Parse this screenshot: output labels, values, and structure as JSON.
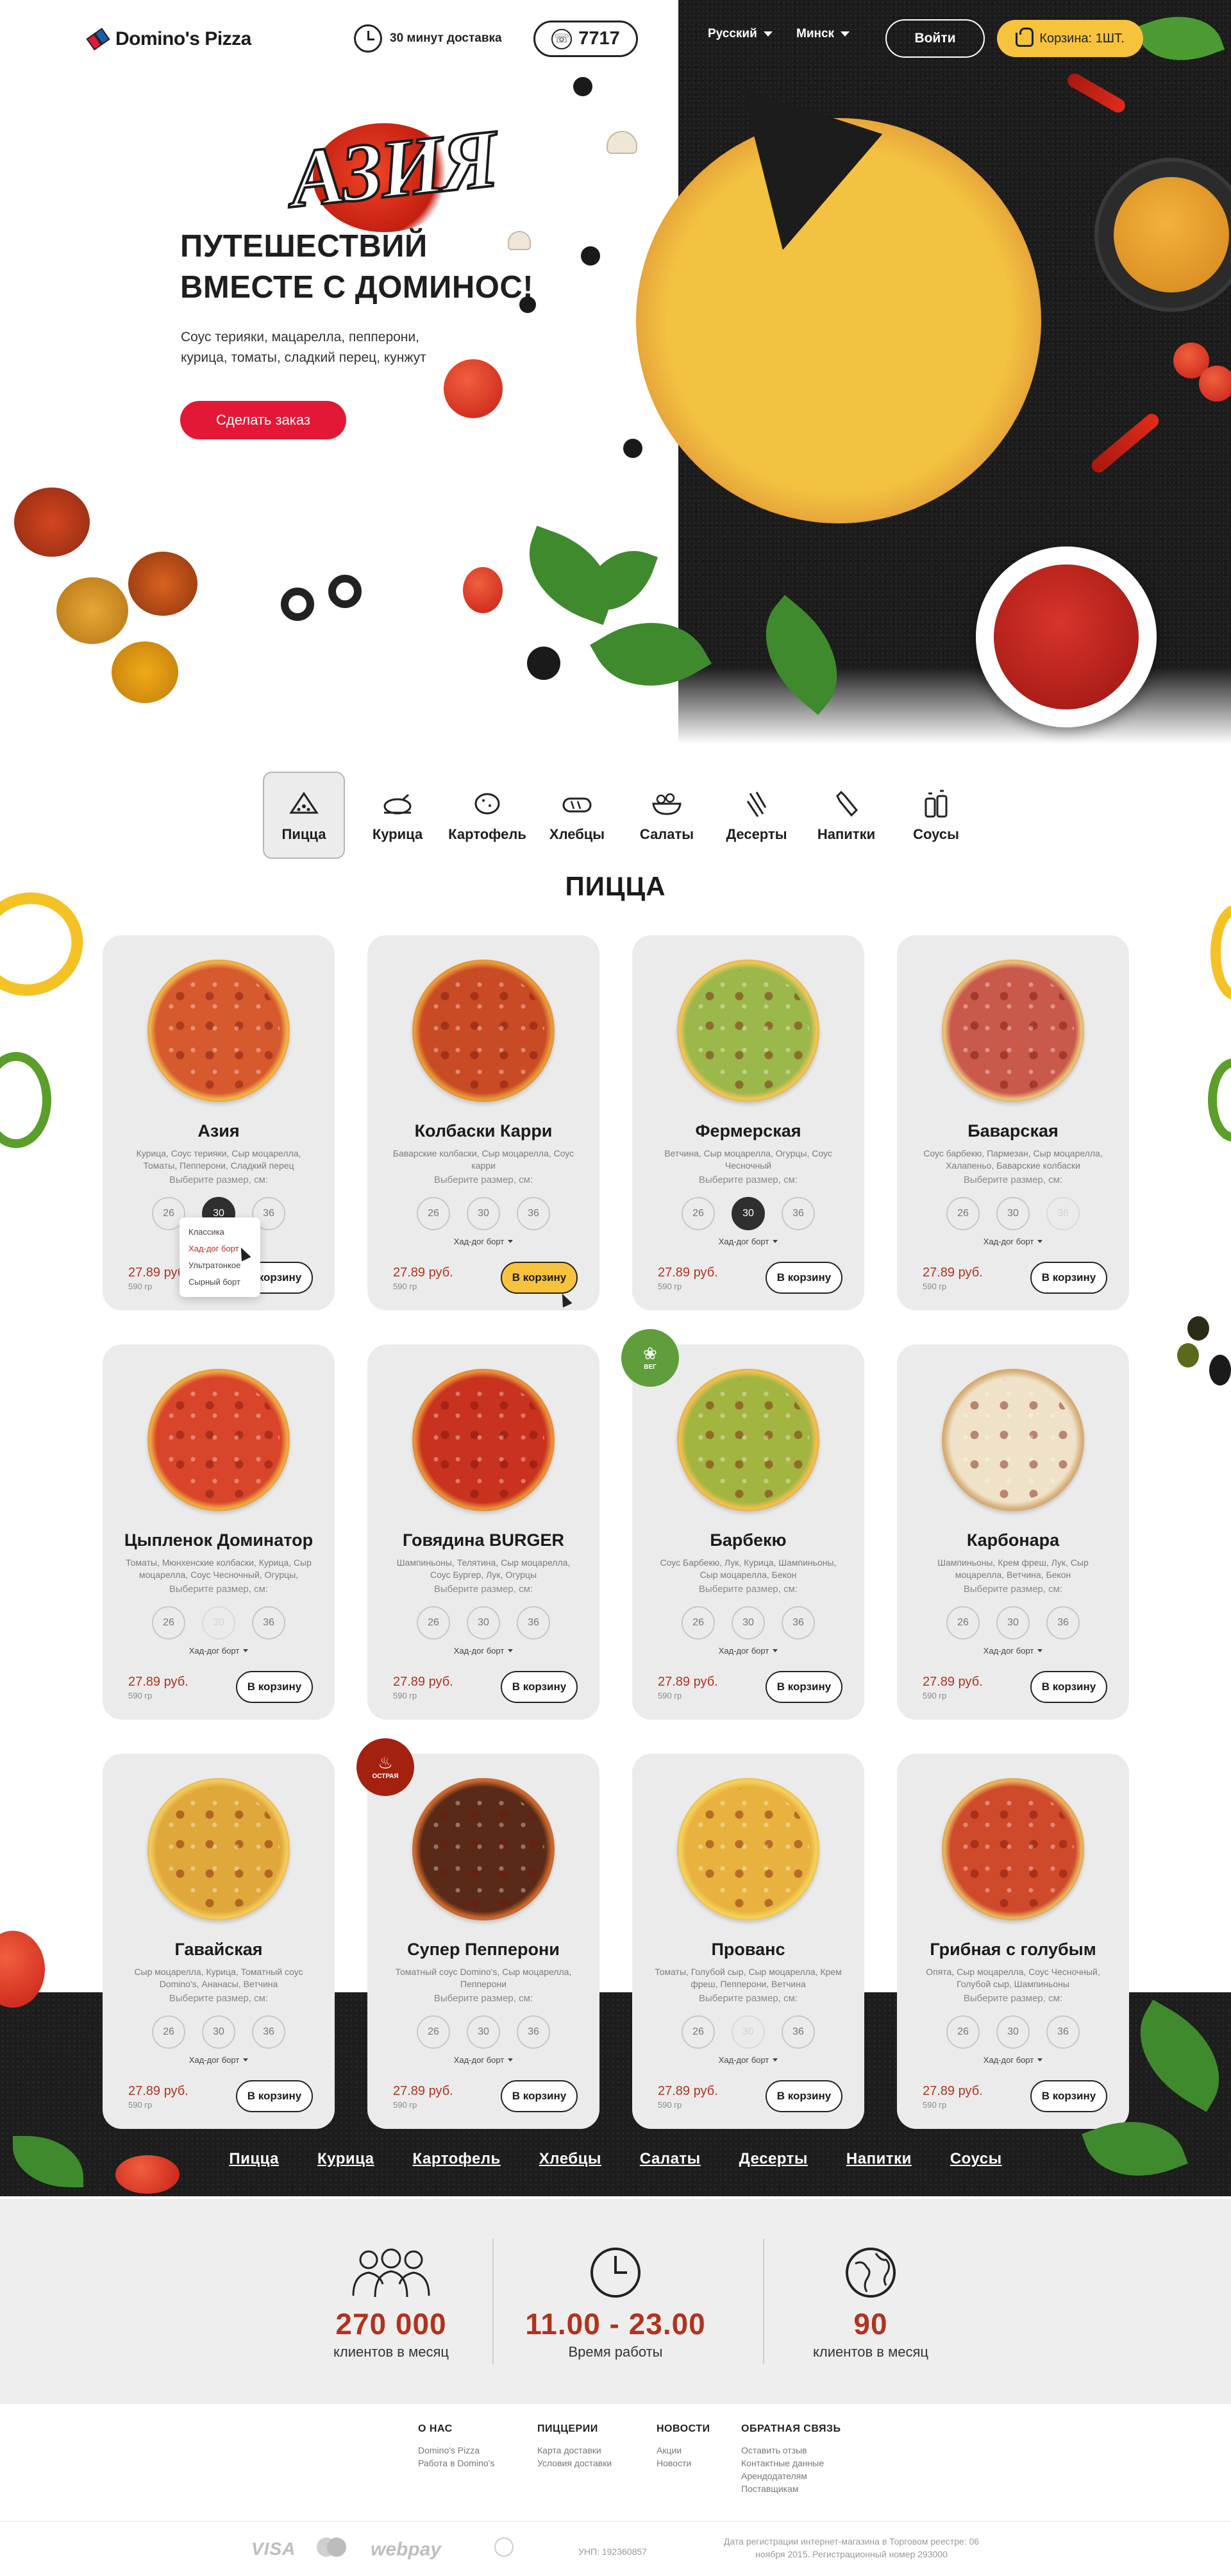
{
  "header": {
    "logo_text": "Domino's Pizza",
    "delivery_text": "30 минут доставка",
    "phone": "7717",
    "language": "Русский",
    "city": "Минск",
    "login_label": "Войти",
    "cart_label": "Корзина: 1ШТ."
  },
  "hero": {
    "word": "АЗИЯ",
    "title_line1": "ПУТЕШЕСТВИЙ",
    "title_line2": "ВМЕСТЕ С ДОМИНОС!",
    "description": "Соус терияки, мацарелла, пепперони, курица, томаты, сладкий перец, кунжут",
    "cta_label": "Сделать заказ"
  },
  "categories": [
    {
      "label": "Пицца",
      "icon": "pizza-slice-icon",
      "active": true
    },
    {
      "label": "Курица",
      "icon": "chicken-icon"
    },
    {
      "label": "Картофель",
      "icon": "potato-icon"
    },
    {
      "label": "Хлебцы",
      "icon": "bread-icon"
    },
    {
      "label": "Салаты",
      "icon": "salad-icon"
    },
    {
      "label": "Десерты",
      "icon": "dessert-icon"
    },
    {
      "label": "Напитки",
      "icon": "drink-icon"
    },
    {
      "label": "Соусы",
      "icon": "sauce-icon"
    }
  ],
  "section_title": "ПИЦЦА",
  "card_common": {
    "size_label": "Выберите размер, см:",
    "sizes": [
      "26",
      "30",
      "36"
    ],
    "crust": "Хад-дог борт",
    "price": "27.89 руб.",
    "weight": "590 гр",
    "add_label": "В корзину"
  },
  "crust_dropdown": [
    "Классика",
    "Хад-дог борт",
    "Ультратонкое",
    "Сырный борт"
  ],
  "pizzas": [
    {
      "name": "Азия",
      "ingredients": "Курица, Соус терияки, Сыр моцарелла, Томаты, Пепперони, Сладкий перец"
    },
    {
      "name": "Колбаски Карри",
      "ingredients": "Баварские колбаски, Сыр моцарелла, Соус карри"
    },
    {
      "name": "Фермерская",
      "ingredients": "Ветчина, Сыр моцарелла, Огурцы, Соус Чесночный"
    },
    {
      "name": "Баварская",
      "ingredients": "Соус барбекю, Пармезан, Сыр моцарелла, Халапеньо, Баварские колбаски"
    },
    {
      "name": "Цыпленок Доминатор",
      "ingredients": "Томаты, Мюнхенские колбаски, Курица, Сыр моцарелла, Соус Чесночный, Огурцы,"
    },
    {
      "name": "Говядина BURGER",
      "ingredients": "Шампиньоны, Телятина, Сыр моцарелла, Соус Бургер, Лук, Огурцы"
    },
    {
      "name": "Барбекю",
      "ingredients": "Соус Барбекю, Лук, Курица, Шампиньоны, Сыр моцарелла, Бекон",
      "badge": "veg"
    },
    {
      "name": "Карбонара",
      "ingredients": "Шампиньоны, Крем фреш, Лук, Сыр моцарелла, Ветчина, Бекон"
    },
    {
      "name": "Гавайская",
      "ingredients": "Сыр моцарелла, Курица, Томатный соус Domino's, Ананасы, Ветчина"
    },
    {
      "name": "Супер Пепперони",
      "ingredients": "Томатный соус Domino's, Сыр моцарелла, Пепперони",
      "badge": "hot"
    },
    {
      "name": "Прованс",
      "ingredients": "Томаты, Голубой сыр, Сыр моцарелла, Крем фреш, Пепперони, Ветчина"
    },
    {
      "name": "Грибная с голубым",
      "ingredients": "Опята, Сыр моцарелла, Соус Чесночный, Голубой сыр, Шампиньоны"
    }
  ],
  "badges": {
    "veg": "ВЕГ",
    "hot": "ОСТРАЯ"
  },
  "bottom_nav": [
    "Пицца",
    "Курица",
    "Картофель",
    "Хлебцы",
    "Салаты",
    "Десерты",
    "Напитки",
    "Соусы"
  ],
  "stats": [
    {
      "value": "270 000",
      "label": "клиентов в месяц",
      "icon": "team-icon"
    },
    {
      "value": "11.00 - 23.00",
      "label": "Время работы",
      "icon": "clock-icon"
    },
    {
      "value": "90",
      "label": "клиентов в месяц",
      "icon": "globe-icon"
    }
  ],
  "footer": {
    "columns": [
      {
        "heading": "О НАС",
        "items": [
          "Domino's Pizza",
          "Работа в Domino's"
        ]
      },
      {
        "heading": "ПИЦЦЕРИИ",
        "items": [
          "Карта доставки",
          "Условия доставки"
        ]
      },
      {
        "heading": "НОВОСТИ",
        "items": [
          "Акции",
          "Новости"
        ]
      },
      {
        "heading": "ОБРАТНАЯ СВЯЗЬ",
        "items": [
          "Оставить отзыв",
          "Контактные данные",
          "Арендодателям",
          "Поставщикам"
        ]
      }
    ],
    "visa": "VISA",
    "webpay": "webpay",
    "unp": "УНП: 192360857",
    "registration": "Дата регистрации интернет-магазина в Торговом реестре: 06 ноября 2015. Регистрационный номер 293000"
  },
  "colors": {
    "brand_red": "#e31837",
    "accent_yellow": "#f7c33c",
    "price_red": "#b1331d",
    "dark_bg": "#1c1c1c"
  }
}
